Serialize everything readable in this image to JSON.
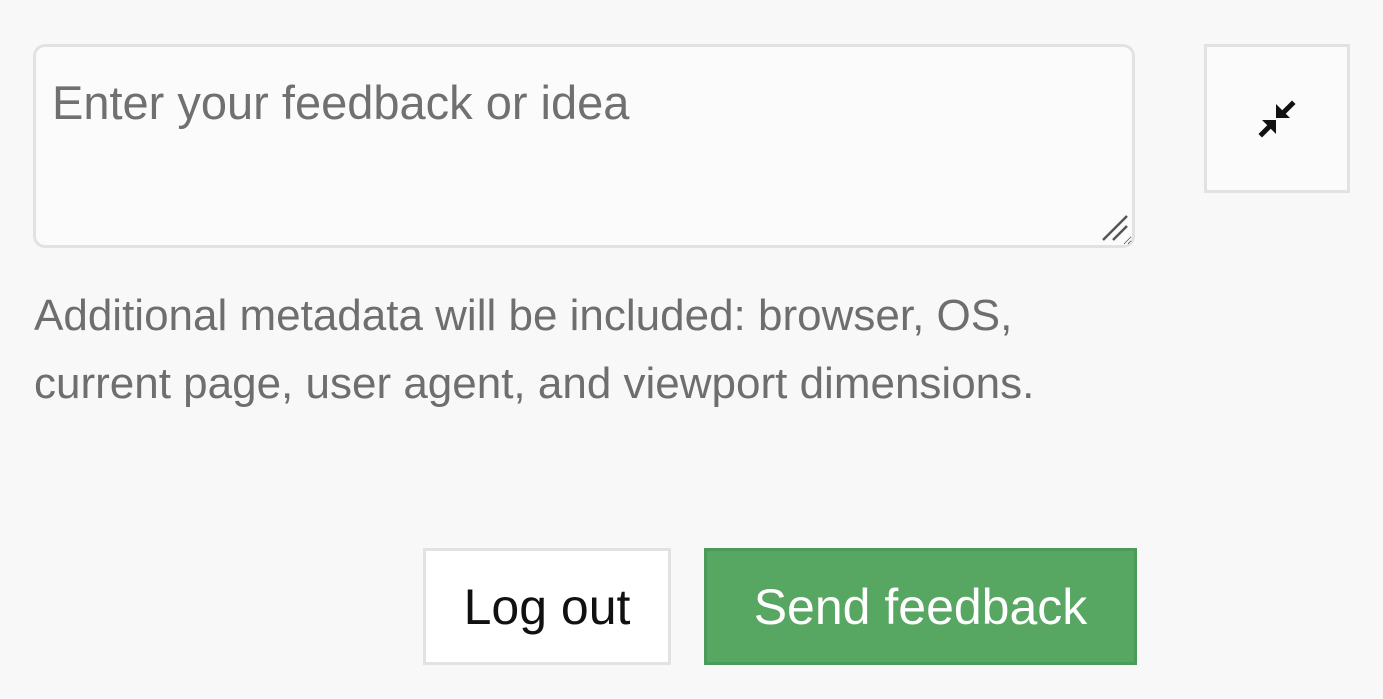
{
  "feedback": {
    "placeholder": "Enter your feedback or idea",
    "value": "",
    "metadata_note": "Additional metadata will be included: browser, OS, current page, user agent, and viewport dimensions."
  },
  "actions": {
    "logout_label": "Log out",
    "send_label": "Send feedback"
  },
  "icons": {
    "collapse": "collapse-arrows-icon",
    "resize": "resize-handle-icon"
  },
  "colors": {
    "background": "#f8f8f8",
    "send_button": "#57a763",
    "muted_text": "#6e6e6e",
    "border": "#e2e2e2"
  }
}
